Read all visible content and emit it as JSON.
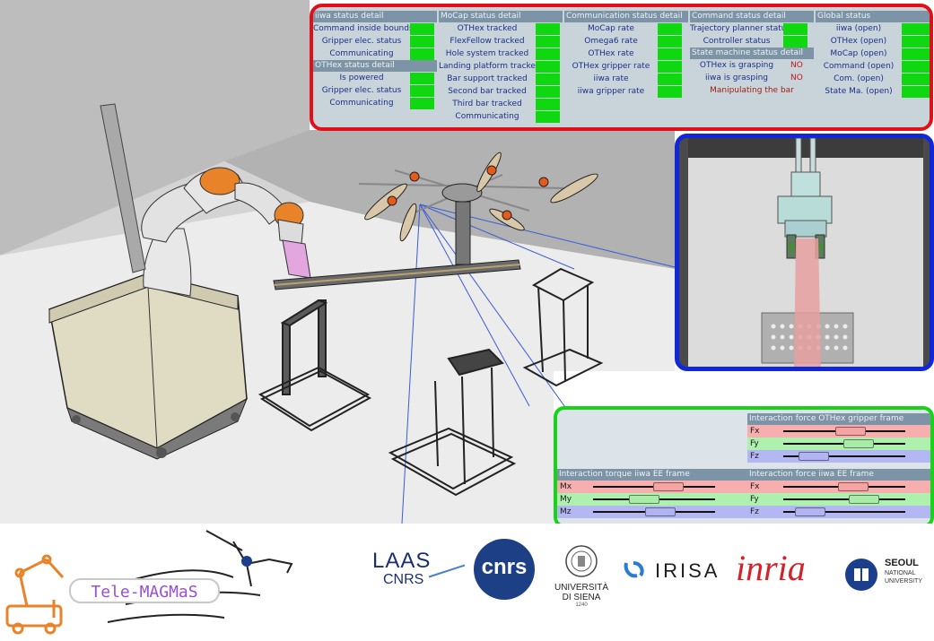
{
  "status_panel": {
    "iiwa": {
      "title": "iiwa status detail",
      "rows": [
        "Command inside bounds",
        "Gripper elec. status",
        "Communicating"
      ]
    },
    "othex": {
      "title": "OTHex status detail",
      "rows": [
        "Is powered",
        "Gripper elec. status",
        "Communicating"
      ]
    },
    "mocap": {
      "title": "MoCap status detail",
      "rows": [
        "OTHex tracked",
        "FlexFellow tracked",
        "Hole system tracked",
        "Landing platform tracked",
        "Bar support tracked",
        "Second bar tracked",
        "Third bar tracked",
        "Communicating"
      ]
    },
    "communication": {
      "title": "Communication status detail",
      "rows": [
        "MoCap rate",
        "Omega6 rate",
        "OTHex rate",
        "OTHex gripper rate",
        "iiwa rate",
        "iiwa gripper rate"
      ]
    },
    "command": {
      "title": "Command status detail",
      "rows": [
        "Trajectory planner status",
        "Controller status"
      ]
    },
    "state_machine": {
      "title": "State machine status detail",
      "rows": [
        {
          "label": "OTHex is grasping",
          "value": "NO"
        },
        {
          "label": "iiwa is grasping",
          "value": "NO"
        },
        {
          "label": "Manipulating the bar",
          "value": ""
        }
      ]
    },
    "global": {
      "title": "Global status",
      "rows": [
        "iiwa (open)",
        "OTHex (open)",
        "MoCap (open)",
        "Command (open)",
        "Com. (open)",
        "State Ma. (open)"
      ]
    },
    "indicator_color": "#10d810"
  },
  "force_panel": {
    "othex_force": {
      "title": "Interaction force OTHex gripper frame",
      "rows": [
        {
          "label": "Fx",
          "value": 0.55
        },
        {
          "label": "Fy",
          "value": 0.62
        },
        {
          "label": "Fz",
          "value": 0.25
        }
      ]
    },
    "iiwa_torque": {
      "title": "Interaction torque iiwa EE frame",
      "rows": [
        {
          "label": "Mx",
          "value": 0.62
        },
        {
          "label": "My",
          "value": 0.42
        },
        {
          "label": "Mz",
          "value": 0.55
        }
      ]
    },
    "iiwa_force": {
      "title": "Interaction force iiwa EE frame",
      "rows": [
        {
          "label": "Fx",
          "value": 0.57
        },
        {
          "label": "Fy",
          "value": 0.66
        },
        {
          "label": "Fz",
          "value": 0.22
        }
      ]
    }
  },
  "logos": {
    "project": "Tele-MAGMaS",
    "laas_line1": "LAAS",
    "laas_line2": "CNRS",
    "cnrs": "cnrs",
    "siena_line1": "UNIVERSITÀ",
    "siena_line2": "DI SIENA",
    "siena_year": "1240",
    "irisa": "IRISA",
    "inria": "inria",
    "snu_line1": "SEOUL",
    "snu_line2": "NATIONAL",
    "snu_line3": "UNIVERSITY"
  }
}
